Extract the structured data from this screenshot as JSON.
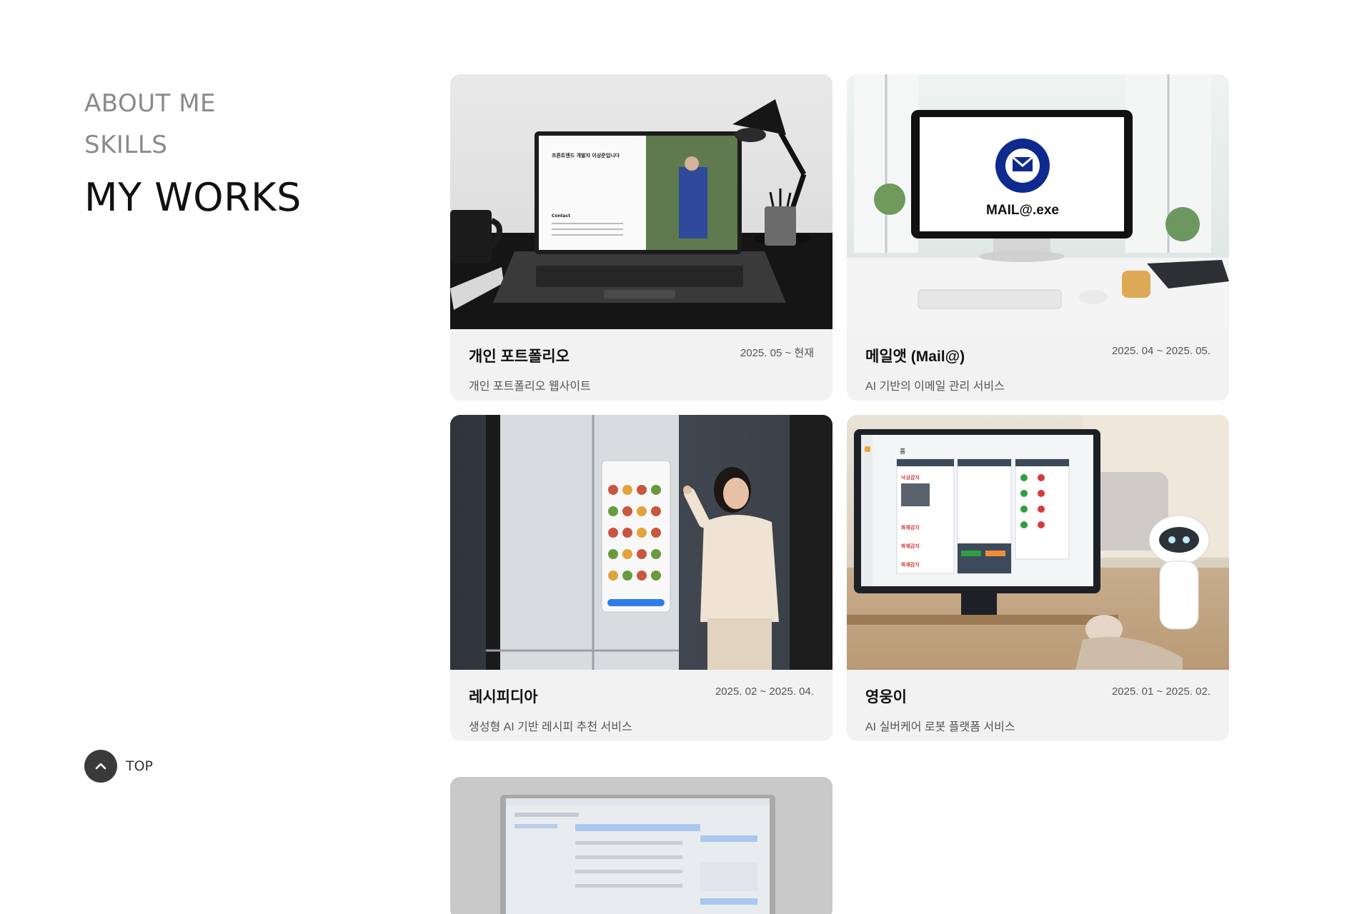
{
  "nav": {
    "about": "ABOUT ME",
    "skills": "SKILLS",
    "works": "MY WORKS",
    "top": "TOP"
  },
  "projects": [
    {
      "title": "개인 포트폴리오",
      "date": "2025. 05 ~ 현재",
      "desc": "개인 포트폴리오 웹사이트",
      "screen_heading": "프론트엔드 개발자 이상준입니다",
      "screen_contact": "Contact"
    },
    {
      "title": "메일앳 (Mail@)",
      "date": "2025. 04 ~ 2025. 05.",
      "desc": "AI 기반의 이메일 관리 서비스",
      "logo_text": "MAIL@.exe"
    },
    {
      "title": "레시피디아",
      "date": "2025. 02 ~ 2025. 04.",
      "desc": "생성형 AI 기반 레시피 추천 서비스"
    },
    {
      "title": "영웅이",
      "date": "2025. 01 ~ 2025. 02.",
      "desc": "AI 실버케어 로봇 플랫폼 서비스",
      "screen_tab": "홈",
      "screen_labels": [
        "낙상감지",
        "화재감지",
        "화재감지",
        "화재감지"
      ]
    },
    {
      "title": "",
      "date": "",
      "desc": ""
    }
  ],
  "colors": {
    "card_bg": "#f2f2f3",
    "nav_inactive": "#8a8a8a",
    "nav_active": "#111111",
    "top_button": "#3a3a3a",
    "brand_blue": "#0e2a8f"
  }
}
